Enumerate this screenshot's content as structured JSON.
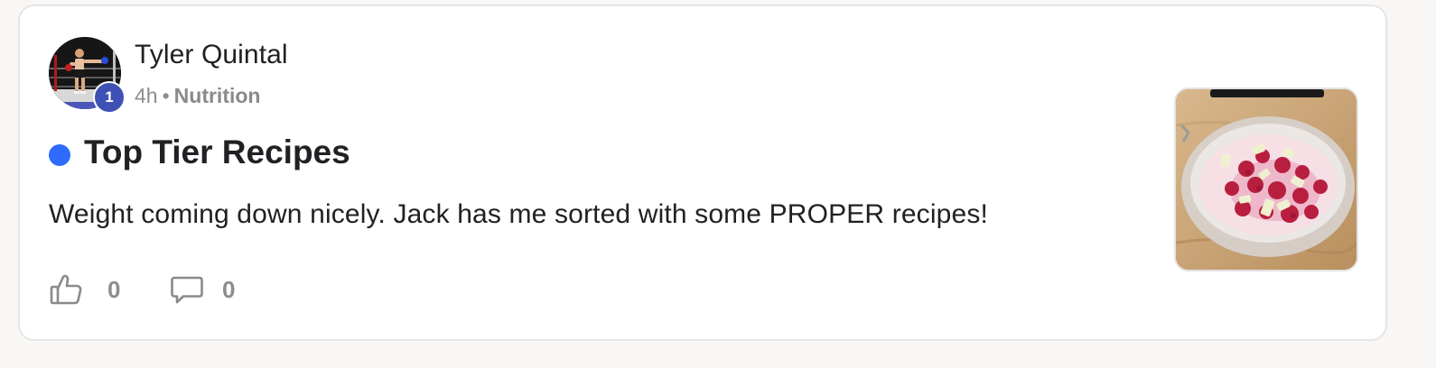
{
  "post": {
    "author": {
      "name": "Tyler Quintal",
      "avatar_icon": "boxer-avatar",
      "level": "1",
      "level_color": "#3f51b5"
    },
    "meta": {
      "time": "4h",
      "separator": "•",
      "category": "Nutrition"
    },
    "unread_indicator_color": "#2f6bff",
    "title": "Top Tier Recipes",
    "body": "Weight coming down nicely. Jack has me sorted with some PROPER recipes!",
    "actions": {
      "like_icon": "thumbs-up-icon",
      "like_count": "0",
      "comment_icon": "comment-bubble-icon",
      "comment_count": "0"
    },
    "thumbnail": {
      "subject": "raspberry yogurt bowl photo"
    }
  }
}
